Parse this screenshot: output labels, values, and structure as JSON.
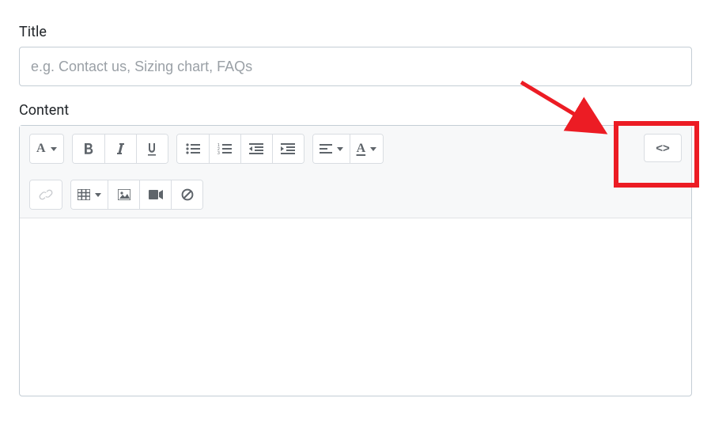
{
  "labels": {
    "title": "Title",
    "content": "Content"
  },
  "title_field": {
    "placeholder": "e.g. Contact us, Sizing chart, FAQs",
    "value": ""
  },
  "toolbar": {
    "font_style_label": "A",
    "color_label": "A",
    "html_label": "<>"
  },
  "annotation": {
    "highlight": "html-button",
    "color": "#ec1c24"
  }
}
